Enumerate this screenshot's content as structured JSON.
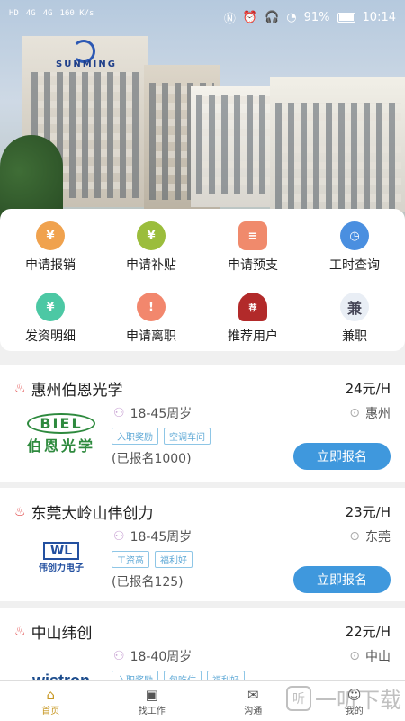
{
  "status_bar": {
    "left_indicators": [
      "HD",
      "4G",
      "4G",
      "160 K/s"
    ],
    "battery": "91%",
    "time": "10:14"
  },
  "hero": {
    "logo_text": "SUNMING"
  },
  "menu": {
    "items": [
      {
        "label": "申请报销",
        "icon": "money-bag-icon",
        "color": "#f0a24e"
      },
      {
        "label": "申请补贴",
        "icon": "money-bag-icon",
        "color": "#9bbd3c"
      },
      {
        "label": "申请预支",
        "icon": "document-icon",
        "color": "#f08a6c"
      },
      {
        "label": "工时查询",
        "icon": "clock-icon",
        "color": "#4a8fe0"
      },
      {
        "label": "发资明细",
        "icon": "yen-icon",
        "color": "#4cc8a4"
      },
      {
        "label": "申请离职",
        "icon": "exclaim-icon",
        "color": "#f2876d"
      },
      {
        "label": "推荐用户",
        "icon": "recommend-badge-icon",
        "color": "#b22a2a"
      },
      {
        "label": "兼职",
        "icon": "part-time-icon",
        "color": "#556"
      }
    ]
  },
  "jobs": [
    {
      "title": "惠州伯恩光学",
      "salary": "24元/H",
      "age": "18-45周岁",
      "location": "惠州",
      "tags": [
        "入职奖励",
        "空调车间"
      ],
      "signed": "(已报名1000)",
      "apply": "立即报名",
      "logo_en": "BIEL",
      "logo_cn": "伯恩光学"
    },
    {
      "title": "东莞大岭山伟创力",
      "salary": "23元/H",
      "age": "18-45周岁",
      "location": "东莞",
      "tags": [
        "工资高",
        "福利好"
      ],
      "signed": "(已报名125)",
      "apply": "立即报名",
      "logo_en": "WL",
      "logo_cn": "伟创力电子"
    },
    {
      "title": "中山纬创",
      "salary": "22元/H",
      "age": "18-40周岁",
      "location": "中山",
      "tags": [
        "入职奖励",
        "包吃住",
        "福利好"
      ],
      "signed": "",
      "apply": "",
      "logo_en": "wistron",
      "logo_cn": ""
    }
  ],
  "tabbar": {
    "tabs": [
      {
        "label": "首页",
        "icon": "home-icon"
      },
      {
        "label": "找工作",
        "icon": "briefcase-icon"
      },
      {
        "label": "沟通",
        "icon": "chat-icon"
      },
      {
        "label": "我的",
        "icon": "user-icon"
      }
    ]
  },
  "watermark": {
    "text": "一听下载"
  }
}
